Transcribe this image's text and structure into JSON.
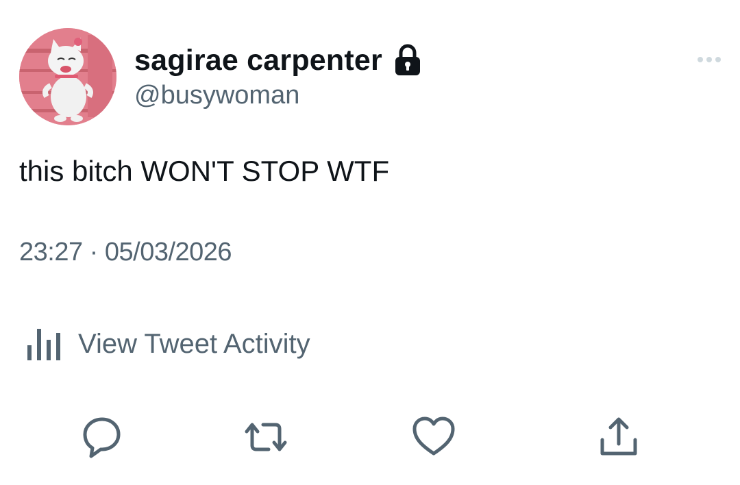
{
  "author": {
    "display_name": "sagirae carpenter",
    "handle": "@busywoman",
    "protected": true,
    "avatar_icon": "cat-avatar",
    "lock_icon": "lock-icon"
  },
  "tweet": {
    "text": "this bitch WON'T STOP WTF",
    "timestamp": "23:27 · 05/03/2026"
  },
  "activity": {
    "label": "View Tweet Activity",
    "icon": "bar-chart-icon"
  },
  "actions": [
    {
      "name": "reply",
      "icon": "reply-icon"
    },
    {
      "name": "retweet",
      "icon": "retweet-icon"
    },
    {
      "name": "like",
      "icon": "heart-icon"
    },
    {
      "name": "share",
      "icon": "share-icon"
    }
  ],
  "more_icon": "more-icon",
  "colors": {
    "primary_text": "#0f1419",
    "secondary_text": "#536471",
    "icon_gray": "#536471",
    "more_gray": "#cfd9de",
    "avatar_bg": "#e0808c"
  }
}
